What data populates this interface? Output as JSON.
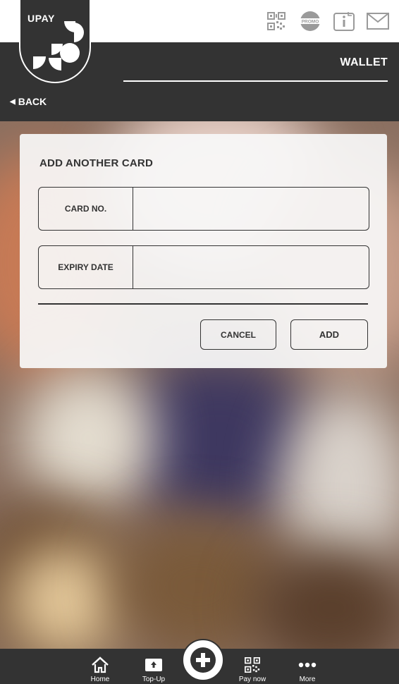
{
  "app": {
    "logo_text": "UPAY",
    "screen_title": "WALLET",
    "back_label": "BACK"
  },
  "top_icons": {
    "qr_icon": "qr-code-icon",
    "promo_icon": "promo-badge-icon",
    "promo_text": "PROMO",
    "info_icon": "info-icon",
    "mail_icon": "mail-icon"
  },
  "card_form": {
    "title": "ADD ANOTHER CARD",
    "card_no_label": "CARD NO.",
    "card_no_value": "",
    "expiry_label": "EXPIRY DATE",
    "expiry_value": "",
    "cancel_label": "CANCEL",
    "add_label": "ADD"
  },
  "bottom_nav": {
    "items": [
      {
        "label": "Home",
        "icon": "home-icon"
      },
      {
        "label": "Top-Up",
        "icon": "top-up-icon"
      },
      {
        "label": "Pay now",
        "icon": "qr-code-icon"
      },
      {
        "label": "More",
        "icon": "more-dots-icon"
      }
    ],
    "fab_icon": "plus-icon"
  },
  "colors": {
    "dark": "#333333",
    "light": "#ffffff",
    "panel": "#f8f8f8"
  }
}
